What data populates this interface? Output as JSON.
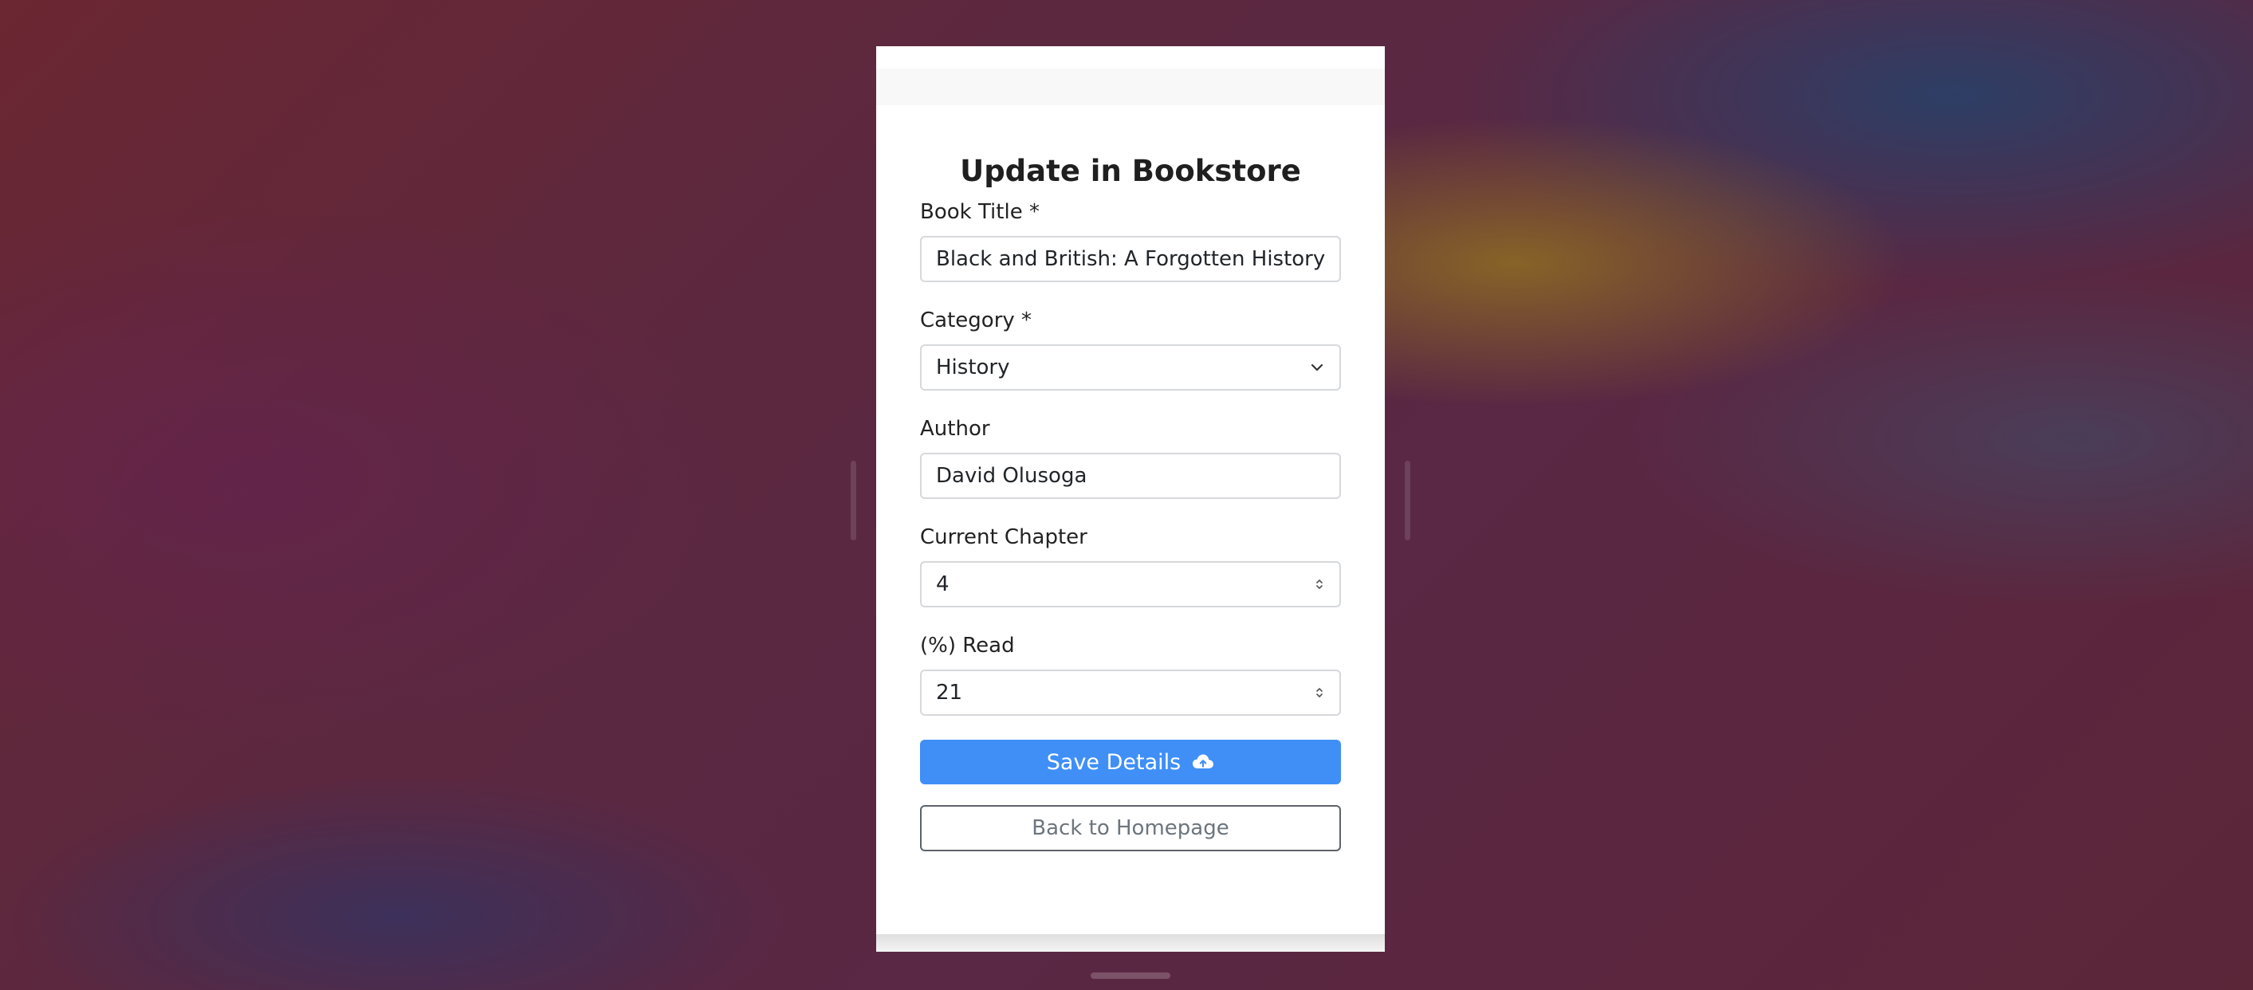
{
  "page": {
    "title": "Update in Bookstore"
  },
  "form": {
    "book_title": {
      "label": "Book Title *",
      "value": "Black and British: A Forgotten History"
    },
    "category": {
      "label": "Category *",
      "value": "History"
    },
    "author": {
      "label": "Author",
      "value": "David Olusoga"
    },
    "current_chapter": {
      "label": "Current Chapter",
      "value": "4"
    },
    "percent_read": {
      "label": "(%) Read",
      "value": "21"
    }
  },
  "actions": {
    "save_label": "Save Details",
    "back_label": "Back to Homepage"
  },
  "icons": {
    "save": "cloud-upload-icon",
    "select": "chevron-down-icon",
    "stepper": "spinner-arrows-icon"
  },
  "colors": {
    "primary_button": "#3f8ff7",
    "outline_button": "#5c636a"
  }
}
